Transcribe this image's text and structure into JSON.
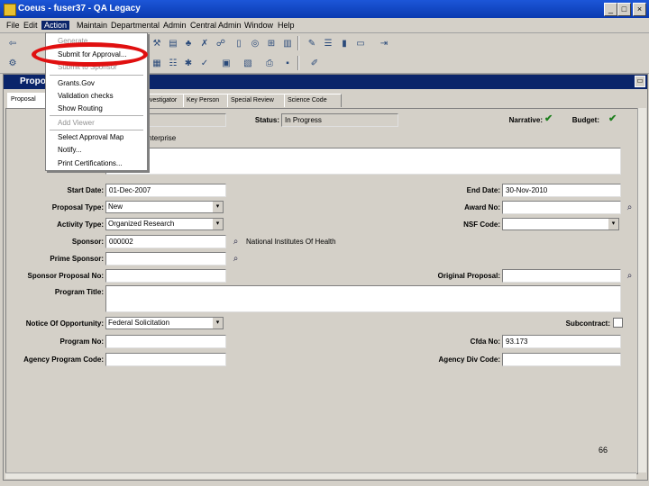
{
  "window": {
    "title": "Coeus - fuser37 - QA Legacy",
    "min": "_",
    "max": "□",
    "close": "×"
  },
  "menubar": [
    "File",
    "Edit",
    "Action",
    "Maintain",
    "Departmental",
    "Admin",
    "Central Admin",
    "Window",
    "Help"
  ],
  "action_menu": {
    "items": [
      {
        "label": "Generate",
        "disabled": true
      },
      {
        "label": "Submit for Approval...",
        "disabled": false
      },
      {
        "label": "Submit to Sponsor",
        "disabled": true
      },
      {
        "label": "Grants.Gov",
        "disabled": false
      },
      {
        "label": "Validation checks",
        "disabled": false
      },
      {
        "label": "Show Routing",
        "disabled": false
      },
      {
        "label": "Add Viewer",
        "disabled": true
      },
      {
        "label": "Select Approval Map",
        "disabled": false
      },
      {
        "label": "Notify...",
        "disabled": false
      },
      {
        "label": "Print Certifications...",
        "disabled": false
      }
    ]
  },
  "inner_window": {
    "title": "Propos"
  },
  "tabs": [
    "Proposal",
    "Investigator",
    "Key Person",
    "Special Review",
    "Science Code"
  ],
  "form": {
    "status_label": "Status:",
    "status_value": "In Progress",
    "narrative_label": "Narrative:",
    "budget_label": "Budget:",
    "institution": "ns Hopkins Enterprise",
    "start_date_label": "Start Date:",
    "start_date": "01-Dec-2007",
    "end_date_label": "End Date:",
    "end_date": "30-Nov-2010",
    "proposal_type_label": "Proposal Type:",
    "proposal_type": "New",
    "award_no_label": "Award No:",
    "award_no": "",
    "activity_type_label": "Activity Type:",
    "activity_type": "Organized Research",
    "nsf_code_label": "NSF Code:",
    "nsf_code": "",
    "sponsor_label": "Sponsor:",
    "sponsor_code": "000002",
    "sponsor_name": "National Institutes Of Health",
    "prime_sponsor_label": "Prime Sponsor:",
    "prime_sponsor": "",
    "sponsor_proposal_no_label": "Sponsor Proposal No:",
    "sponsor_proposal_no": "",
    "original_proposal_label": "Original Proposal:",
    "original_proposal": "",
    "program_title_label": "Program Title:",
    "program_title": "",
    "notice_label": "Notice Of Opportunity:",
    "notice_value": "Federal Solicitation",
    "subcontract_label": "Subcontract:",
    "program_no_label": "Program No:",
    "program_no": "",
    "cfda_no_label": "Cfda No:",
    "cfda_no": "93.173",
    "agency_program_code_label": "Agency Program Code:",
    "agency_program_code": "",
    "agency_div_code_label": "Agency Div Code:",
    "agency_div_code": ""
  },
  "slide_page_number": "66",
  "highlight_color": "#e01010",
  "check_color": "#208020",
  "icons": [
    "search-icon",
    "check-icon",
    "save-icon",
    "print-icon"
  ]
}
